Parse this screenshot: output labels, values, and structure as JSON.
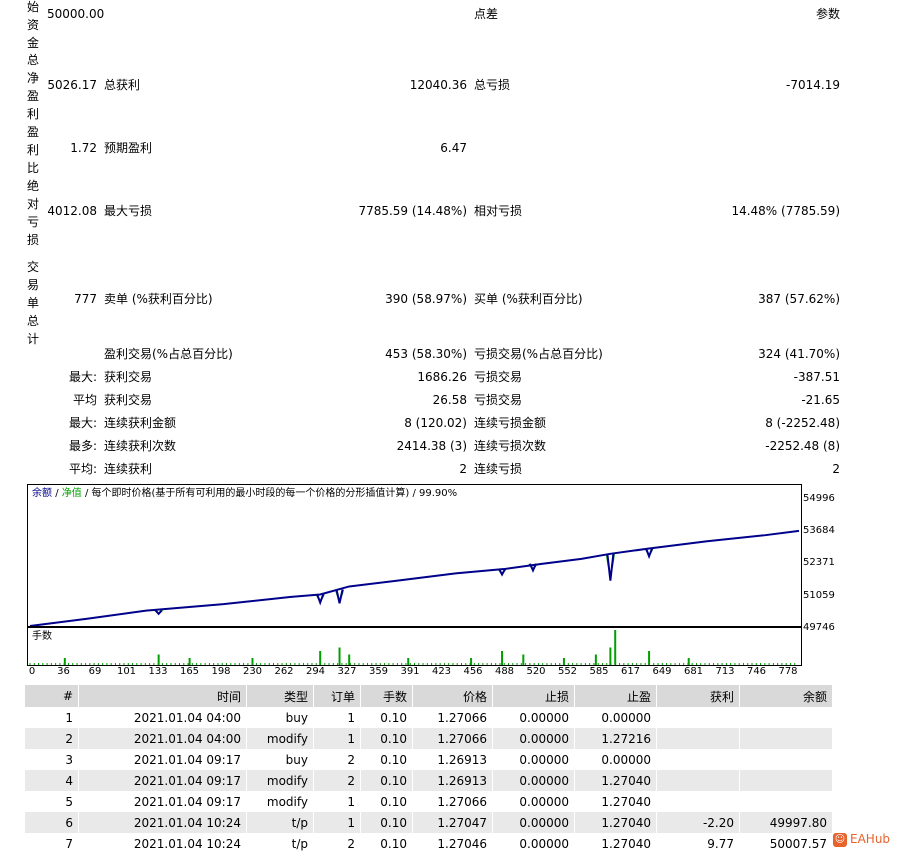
{
  "summary": {
    "vlabels": [
      "始资金",
      "总净盈利",
      "盈利比",
      "绝对亏损",
      "交易单总计"
    ],
    "initial_deposit": "50000.00",
    "spread_label": "点差",
    "params_label": "参数",
    "net_profit": "5026.17",
    "gross_profit_label": "总获利",
    "gross_profit": "12040.36",
    "gross_loss_label": "总亏损",
    "gross_loss": "-7014.19",
    "profit_factor": "1.72",
    "expected_payoff_label": "预期盈利",
    "expected_payoff": "6.47",
    "absolute_drawdown": "4012.08",
    "max_drawdown_label": "最大亏损",
    "max_drawdown": "7785.59 (14.48%)",
    "relative_drawdown_label": "相对亏损",
    "relative_drawdown": "14.48% (7785.59)",
    "total_trades": "777",
    "short_label": "卖单 (%获利百分比)",
    "short_value": "390 (58.97%)",
    "long_label": "买单 (%获利百分比)",
    "long_value": "387 (57.62%)",
    "profit_trades_label": "盈利交易(%占总百分比)",
    "profit_trades_value": "453 (58.30%)",
    "loss_trades_label": "亏损交易(%占总百分比)",
    "loss_trades_value": "324 (41.70%)",
    "rows": [
      {
        "prefix": "最大:",
        "left_label": "获利交易",
        "left_value": "1686.26",
        "right_label": "亏损交易",
        "right_value": "-387.51"
      },
      {
        "prefix": "平均",
        "left_label": "获利交易",
        "left_value": "26.58",
        "right_label": "亏损交易",
        "right_value": "-21.65"
      },
      {
        "prefix": "最大:",
        "left_label": "连续获利金额",
        "left_value": "8 (120.02)",
        "right_label": "连续亏损金额",
        "right_value": "8 (-2252.48)"
      },
      {
        "prefix": "最多:",
        "left_label": "连续获利次数",
        "left_value": "2414.38 (3)",
        "right_label": "连续亏损次数",
        "right_value": "-2252.48 (8)"
      },
      {
        "prefix": "平均:",
        "left_label": "连续获利",
        "left_value": "2",
        "right_label": "连续亏损",
        "right_value": "2"
      }
    ]
  },
  "chart": {
    "legend_balance": "余额",
    "legend_equity": "净值",
    "legend_rest": "/ 每个即时价格(基于所有可利用的最小时段的每一个价格的分形插值计算) / 99.90%",
    "volume_label": "手数",
    "balance_color": "#00008b",
    "equity_color": "#00a000",
    "volume_color": "#00a000"
  },
  "chart_data": {
    "type": "line",
    "y_ticks": [
      "54996",
      "53684",
      "52371",
      "51059",
      "49746"
    ],
    "x_ticks": [
      "0",
      "36",
      "69",
      "101",
      "133",
      "165",
      "198",
      "230",
      "262",
      "294",
      "327",
      "359",
      "391",
      "423",
      "456",
      "488",
      "520",
      "552",
      "585",
      "617",
      "649",
      "681",
      "713",
      "746",
      "778"
    ],
    "ylim": [
      49746,
      54996
    ],
    "xlim": [
      0,
      795
    ],
    "series": [
      {
        "name": "余额",
        "points": [
          [
            0,
            49746
          ],
          [
            60,
            50050
          ],
          [
            120,
            50380
          ],
          [
            200,
            50650
          ],
          [
            270,
            50950
          ],
          [
            300,
            51050
          ],
          [
            330,
            51380
          ],
          [
            380,
            51620
          ],
          [
            440,
            51920
          ],
          [
            490,
            52100
          ],
          [
            530,
            52320
          ],
          [
            570,
            52520
          ],
          [
            600,
            52730
          ],
          [
            640,
            52950
          ],
          [
            700,
            53250
          ],
          [
            760,
            53500
          ],
          [
            795,
            53680
          ]
        ]
      },
      {
        "name": "净值",
        "drops": [
          [
            133,
            50390,
            50200
          ],
          [
            300,
            51050,
            50600
          ],
          [
            320,
            51250,
            50500
          ],
          [
            488,
            52100,
            51800
          ],
          [
            520,
            52320,
            51950
          ],
          [
            600,
            52730,
            51250
          ],
          [
            640,
            52950,
            52520
          ]
        ]
      }
    ],
    "volume_spikes": [
      [
        36,
        2
      ],
      [
        133,
        3
      ],
      [
        165,
        2
      ],
      [
        230,
        2
      ],
      [
        300,
        4
      ],
      [
        320,
        5
      ],
      [
        330,
        3
      ],
      [
        391,
        2
      ],
      [
        456,
        2
      ],
      [
        488,
        4
      ],
      [
        510,
        3
      ],
      [
        552,
        2
      ],
      [
        585,
        3
      ],
      [
        600,
        5
      ],
      [
        605,
        10
      ],
      [
        640,
        4
      ],
      [
        681,
        2
      ]
    ]
  },
  "table": {
    "headers": [
      "#",
      "时间",
      "类型",
      "订单",
      "手数",
      "价格",
      "止损",
      "止盈",
      "获利",
      "余额"
    ],
    "rows": [
      [
        "1",
        "2021.01.04 04:00",
        "buy",
        "1",
        "0.10",
        "1.27066",
        "0.00000",
        "0.00000",
        "",
        ""
      ],
      [
        "2",
        "2021.01.04 04:00",
        "modify",
        "1",
        "0.10",
        "1.27066",
        "0.00000",
        "1.27216",
        "",
        ""
      ],
      [
        "3",
        "2021.01.04 09:17",
        "buy",
        "2",
        "0.10",
        "1.26913",
        "0.00000",
        "0.00000",
        "",
        ""
      ],
      [
        "4",
        "2021.01.04 09:17",
        "modify",
        "2",
        "0.10",
        "1.26913",
        "0.00000",
        "1.27040",
        "",
        ""
      ],
      [
        "5",
        "2021.01.04 09:17",
        "modify",
        "1",
        "0.10",
        "1.27066",
        "0.00000",
        "1.27040",
        "",
        ""
      ],
      [
        "6",
        "2021.01.04 10:24",
        "t/p",
        "1",
        "0.10",
        "1.27047",
        "0.00000",
        "1.27040",
        "-2.20",
        "49997.80"
      ],
      [
        "7",
        "2021.01.04 10:24",
        "t/p",
        "2",
        "0.10",
        "1.27046",
        "0.00000",
        "1.27040",
        "9.77",
        "50007.57"
      ]
    ]
  },
  "watermark": "EAHub"
}
